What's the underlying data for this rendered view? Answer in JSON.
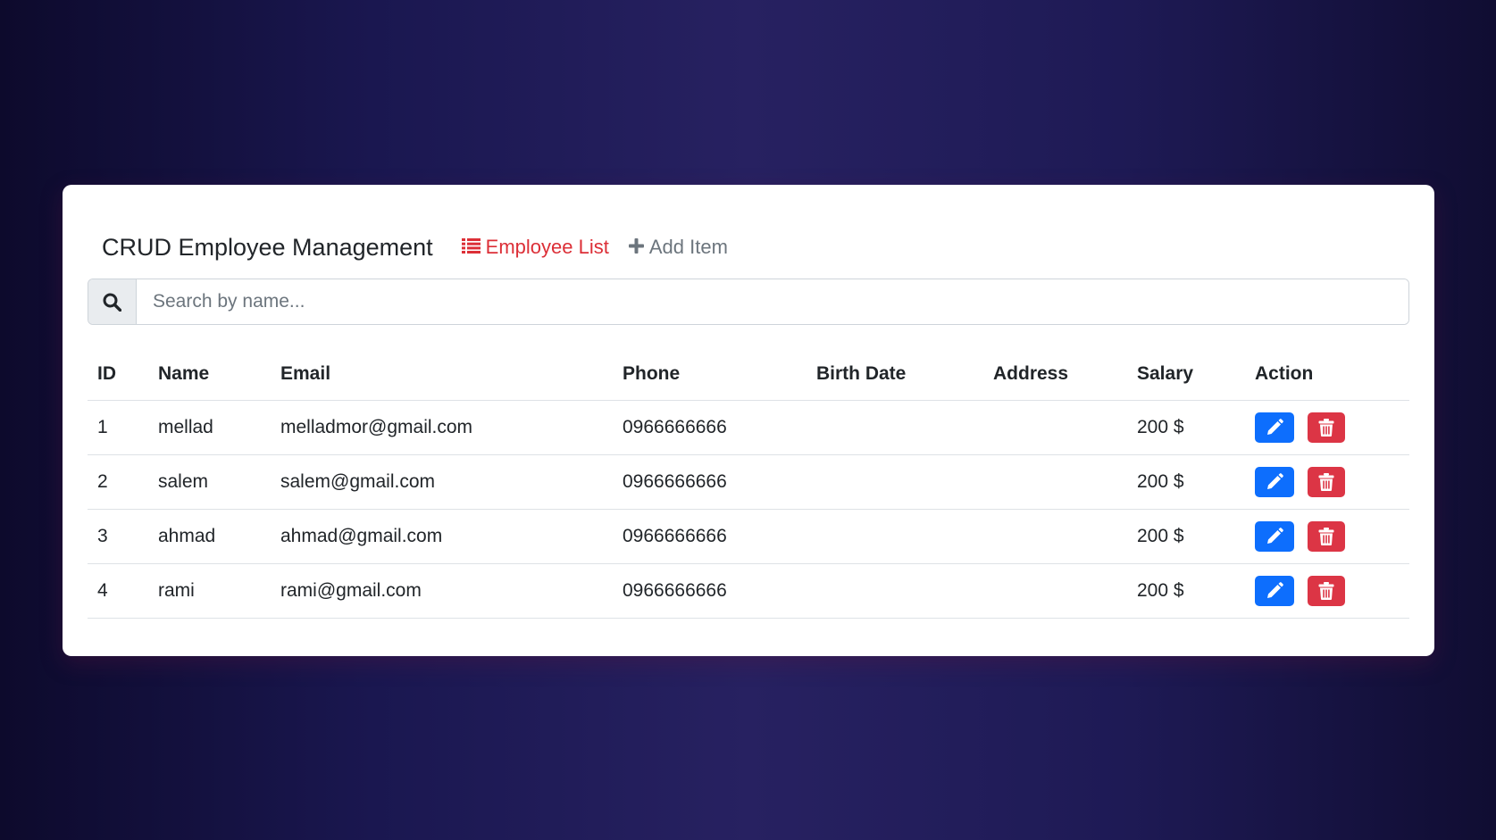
{
  "app": {
    "title": "CRUD Employee Management"
  },
  "nav": {
    "items": [
      {
        "label": "Employee List",
        "icon": "list-icon",
        "active": true
      },
      {
        "label": "Add Item",
        "icon": "plus-icon",
        "active": false
      }
    ]
  },
  "search": {
    "placeholder": "Search by name...",
    "value": "",
    "icon": "search-icon"
  },
  "table": {
    "columns": [
      "ID",
      "Name",
      "Email",
      "Phone",
      "Birth Date",
      "Address",
      "Salary",
      "Action"
    ],
    "rows": [
      {
        "id": "1",
        "name": "mellad",
        "email": "melladmor@gmail.com",
        "phone": "0966666666",
        "birth_date": "",
        "address": "",
        "salary": "200 $"
      },
      {
        "id": "2",
        "name": "salem",
        "email": "salem@gmail.com",
        "phone": "0966666666",
        "birth_date": "",
        "address": "",
        "salary": "200 $"
      },
      {
        "id": "3",
        "name": "ahmad",
        "email": "ahmad@gmail.com",
        "phone": "0966666666",
        "birth_date": "",
        "address": "",
        "salary": "200 $"
      },
      {
        "id": "4",
        "name": "rami",
        "email": "rami@gmail.com",
        "phone": "0966666666",
        "birth_date": "",
        "address": "",
        "salary": "200 $"
      }
    ],
    "actions": {
      "edit_icon": "pencil-icon",
      "delete_icon": "trash-icon"
    }
  },
  "colors": {
    "active_nav": "#dc2f37",
    "inactive_nav": "#6c757d",
    "edit_button": "#0d6efd",
    "delete_button": "#dc3545"
  }
}
